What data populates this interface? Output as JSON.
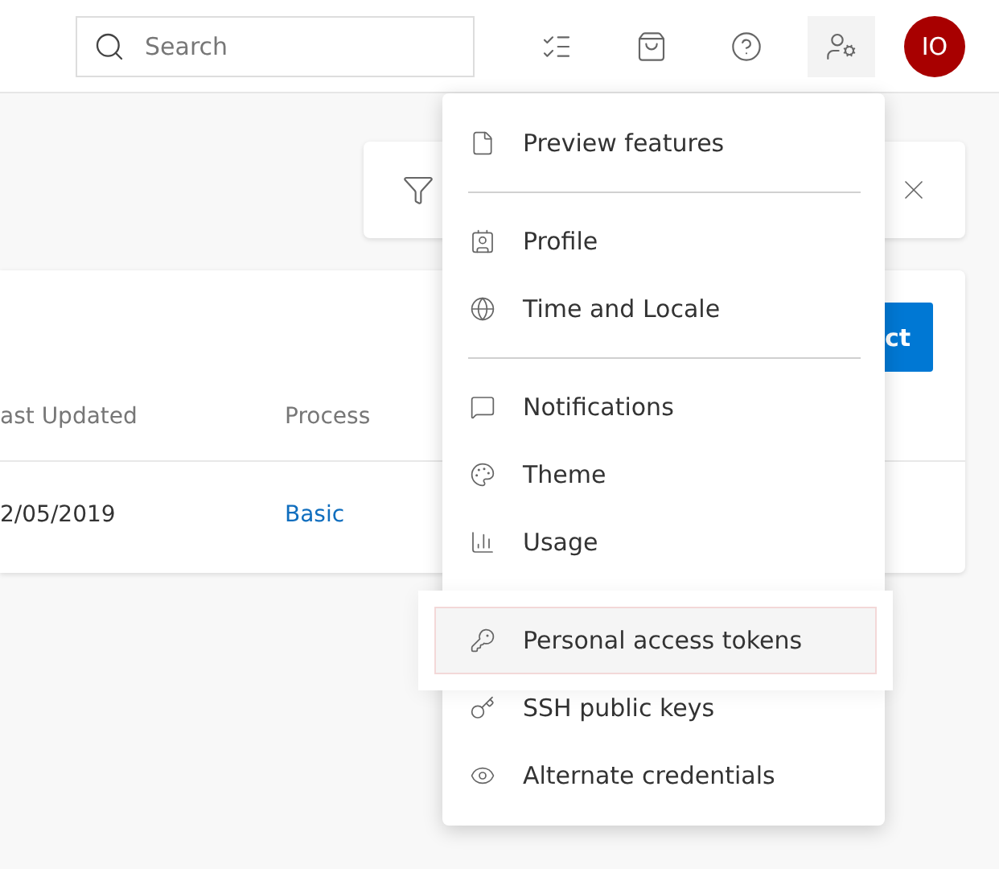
{
  "header": {
    "search": {
      "placeholder": "Search"
    },
    "avatar": {
      "initials": "IO"
    }
  },
  "project_card": {
    "button": "ct",
    "columns": [
      "ast Updated",
      "Process"
    ],
    "rows": [
      {
        "updated": "2/05/2019",
        "process": "Basic"
      }
    ]
  },
  "menu": {
    "groups": [
      {
        "items": [
          {
            "label": "Preview features",
            "selected": false
          }
        ]
      },
      {
        "items": [
          {
            "label": "Profile",
            "selected": false
          },
          {
            "label": "Time and Locale",
            "selected": false
          }
        ]
      },
      {
        "items": [
          {
            "label": "Notifications",
            "selected": false
          },
          {
            "label": "Theme",
            "selected": false
          },
          {
            "label": "Usage",
            "selected": false
          }
        ]
      },
      {
        "items": [
          {
            "label": "Personal access tokens",
            "selected": true
          },
          {
            "label": "SSH public keys",
            "selected": false
          },
          {
            "label": "Alternate credentials",
            "selected": false
          }
        ]
      }
    ]
  }
}
